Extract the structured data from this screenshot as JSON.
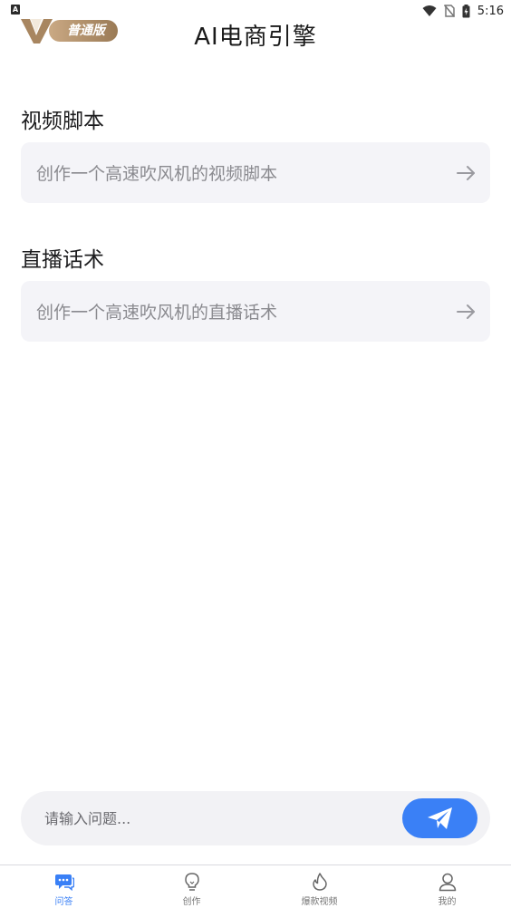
{
  "status_bar": {
    "time": "5:16",
    "left_badge": "A"
  },
  "header": {
    "brand_logo_letter": "V",
    "brand_badge": "普通版",
    "title": "AI电商引擎"
  },
  "sections": [
    {
      "title": "视频脚本",
      "prompt": "创作一个高速吹风机的视频脚本"
    },
    {
      "title": "直播话术",
      "prompt": "创作一个高速吹风机的直播话术"
    }
  ],
  "input": {
    "placeholder": "请输入问题..."
  },
  "nav": {
    "items": [
      {
        "label": "问答",
        "icon": "chat-icon"
      },
      {
        "label": "创作",
        "icon": "lightbulb-icon"
      },
      {
        "label": "爆款视频",
        "icon": "fire-icon"
      },
      {
        "label": "我的",
        "icon": "user-icon"
      }
    ]
  },
  "colors": {
    "accent": "#3a80f6",
    "card_bg": "#f4f4f8",
    "brand_gold": "#b8966c"
  }
}
